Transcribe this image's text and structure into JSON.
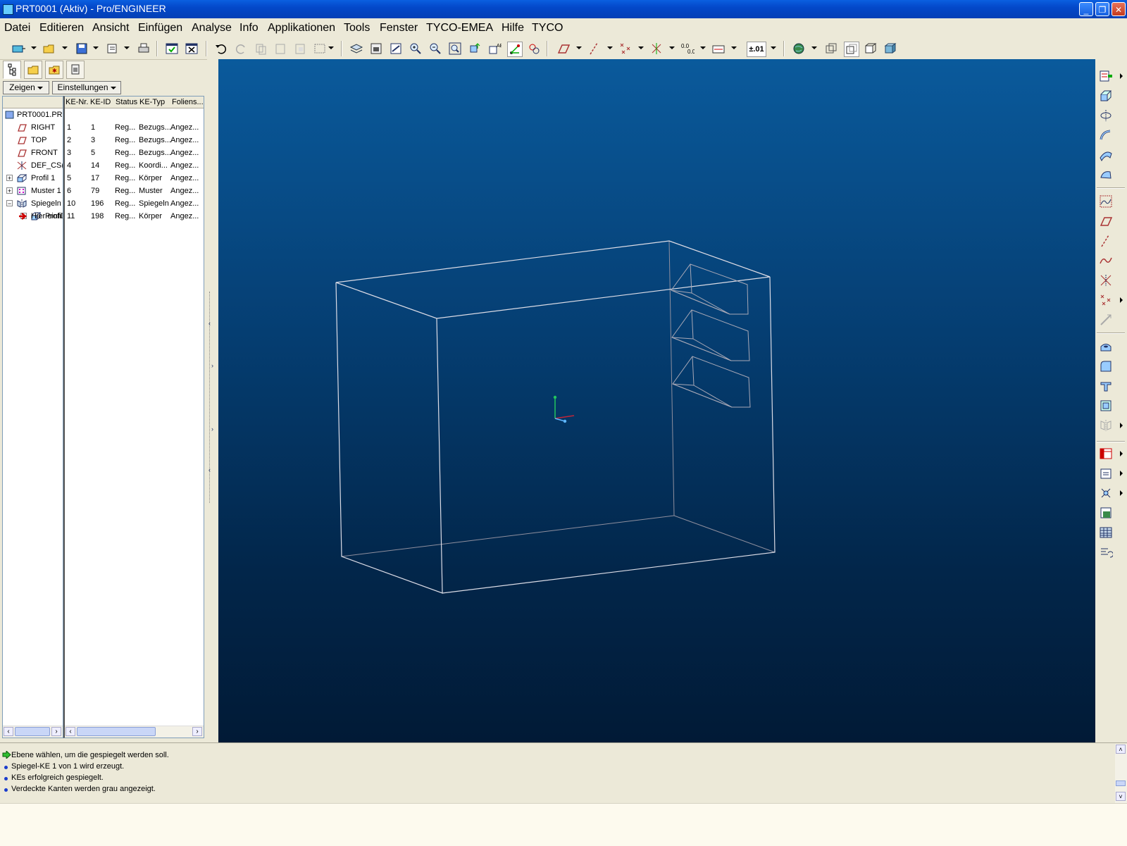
{
  "window": {
    "title": "PRT0001 (Aktiv) - Pro/ENGINEER"
  },
  "menu": [
    "Datei",
    "Editieren",
    "Ansicht",
    "Einfügen",
    "Analyse",
    "Info",
    "Applikationen",
    "Tools",
    "Fenster",
    "TYCO-EMEA",
    "Hilfe",
    "TYCO"
  ],
  "toolbar": {
    "precision_label": "±.01"
  },
  "panel": {
    "show_button": "Zeigen",
    "settings_button": "Einstellungen",
    "columns": [
      "KE-Nr.",
      "KE-ID",
      "Status",
      "KE-Typ",
      "Foliens..."
    ],
    "root": "PRT0001.PR",
    "rows": [
      {
        "name": "RIGHT",
        "nr": "1",
        "id": "1",
        "status": "Reg...",
        "typ": "Bezugs...",
        "folie": "Angez...",
        "icon": "datum-plane-icon"
      },
      {
        "name": "TOP",
        "nr": "2",
        "id": "3",
        "status": "Reg...",
        "typ": "Bezugs...",
        "folie": "Angez...",
        "icon": "datum-plane-icon"
      },
      {
        "name": "FRONT",
        "nr": "3",
        "id": "5",
        "status": "Reg...",
        "typ": "Bezugs...",
        "folie": "Angez...",
        "icon": "datum-plane-icon"
      },
      {
        "name": "DEF_CS(",
        "nr": "4",
        "id": "14",
        "status": "Reg...",
        "typ": "Koordi...",
        "folie": "Angez...",
        "icon": "coordinate-system-icon"
      },
      {
        "name": "Profil 1",
        "nr": "5",
        "id": "17",
        "status": "Reg...",
        "typ": "Körper",
        "folie": "Angez...",
        "icon": "extrude-icon"
      },
      {
        "name": "Muster 1",
        "nr": "6",
        "id": "79",
        "status": "Reg...",
        "typ": "Muster",
        "folie": "Angez...",
        "icon": "pattern-icon"
      },
      {
        "name": "Spiegeln",
        "nr": "10",
        "id": "196",
        "status": "Reg...",
        "typ": "Spiegeln",
        "folie": "Angez...",
        "icon": "mirror-icon"
      },
      {
        "name": "Profil",
        "nr": "11",
        "id": "198",
        "status": "Reg...",
        "typ": "Körper",
        "folie": "Angez...",
        "icon": "extrude-icon"
      }
    ],
    "insert_here": "Hier einfü"
  },
  "messages": [
    "Ebene wählen, um die gespiegelt werden soll.",
    "Spiegel-KE 1 von 1 wird erzeugt.",
    "KEs erfolgreich gespiegelt.",
    "Verdeckte Kanten werden grau angezeigt."
  ],
  "colors": {
    "titlebar": "#0348c9",
    "viewport_top": "#0a5a9c",
    "viewport_bottom": "#011a36",
    "wire": "#d8d8e0"
  }
}
